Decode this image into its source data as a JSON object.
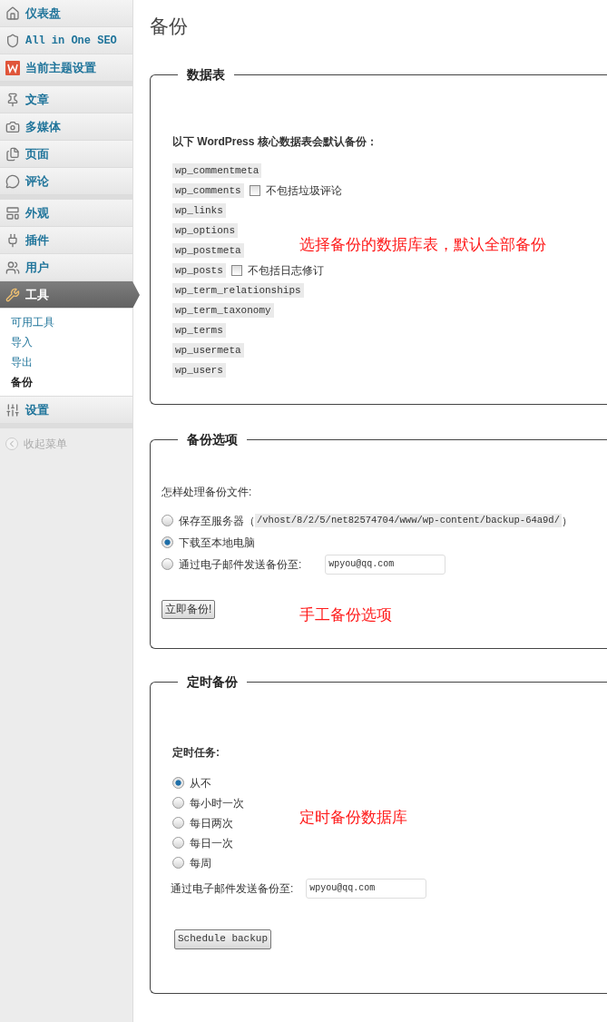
{
  "sidebar": {
    "groups": [
      {
        "items": [
          {
            "label": "仪表盘",
            "selected": false
          },
          {
            "label": "All in One SEO",
            "selected": false
          },
          {
            "label": "当前主题设置",
            "selected": false
          }
        ]
      },
      {
        "items": [
          {
            "label": "文章",
            "selected": false
          },
          {
            "label": "多媒体",
            "selected": false
          },
          {
            "label": "页面",
            "selected": false
          },
          {
            "label": "评论",
            "selected": false
          }
        ]
      },
      {
        "items": [
          {
            "label": "外观",
            "selected": false
          },
          {
            "label": "插件",
            "selected": false
          },
          {
            "label": "用户",
            "selected": false
          },
          {
            "label": "工具",
            "selected": true,
            "children": [
              {
                "label": "可用工具",
                "selected": false
              },
              {
                "label": "导入",
                "selected": false
              },
              {
                "label": "导出",
                "selected": false
              },
              {
                "label": "备份",
                "selected": true
              }
            ]
          },
          {
            "label": "设置",
            "selected": false
          }
        ]
      }
    ],
    "collapse": "收起菜单"
  },
  "page_title": "备份",
  "tables_section": {
    "legend": "数据表",
    "intro": "以下 WordPress 核心数据表会默认备份：",
    "tables": [
      {
        "name": "wp_commentmeta"
      },
      {
        "name": "wp_comments",
        "option": {
          "label": "不包括垃圾评论",
          "checked": false
        }
      },
      {
        "name": "wp_links"
      },
      {
        "name": "wp_options"
      },
      {
        "name": "wp_postmeta"
      },
      {
        "name": "wp_posts",
        "option": {
          "label": "不包括日志修订",
          "checked": false
        }
      },
      {
        "name": "wp_term_relationships"
      },
      {
        "name": "wp_term_taxonomy"
      },
      {
        "name": "wp_terms"
      },
      {
        "name": "wp_usermeta"
      },
      {
        "name": "wp_users"
      }
    ],
    "annotation": "选择备份的数据库表，默认全部备份"
  },
  "options_section": {
    "legend": "备份选项",
    "question": "怎样处理备份文件:",
    "choices": [
      {
        "kind": "path",
        "label": "保存至服务器（",
        "path": "/vhost/8/2/5/net82574704/www/wp-content/backup-64a9d/",
        "suffix": "）",
        "selected": false
      },
      {
        "kind": "plain",
        "label": "下载至本地电脑",
        "selected": true
      },
      {
        "kind": "email",
        "label": "通过电子邮件发送备份至:",
        "value": "wpyou@qq.com",
        "selected": false
      }
    ],
    "button": "立即备份!",
    "annotation": "手工备份选项"
  },
  "schedule_section": {
    "legend": "定时备份",
    "heading": "定时任务:",
    "choices": [
      {
        "label": "从不",
        "selected": true
      },
      {
        "label": "每小时一次",
        "selected": false
      },
      {
        "label": "每日两次",
        "selected": false
      },
      {
        "label": "每日一次",
        "selected": false
      },
      {
        "label": "每周",
        "selected": false
      }
    ],
    "email_label": "通过电子邮件发送备份至:",
    "email_value": "wpyou@qq.com",
    "button": "Schedule backup",
    "annotation": "定时备份数据库"
  }
}
